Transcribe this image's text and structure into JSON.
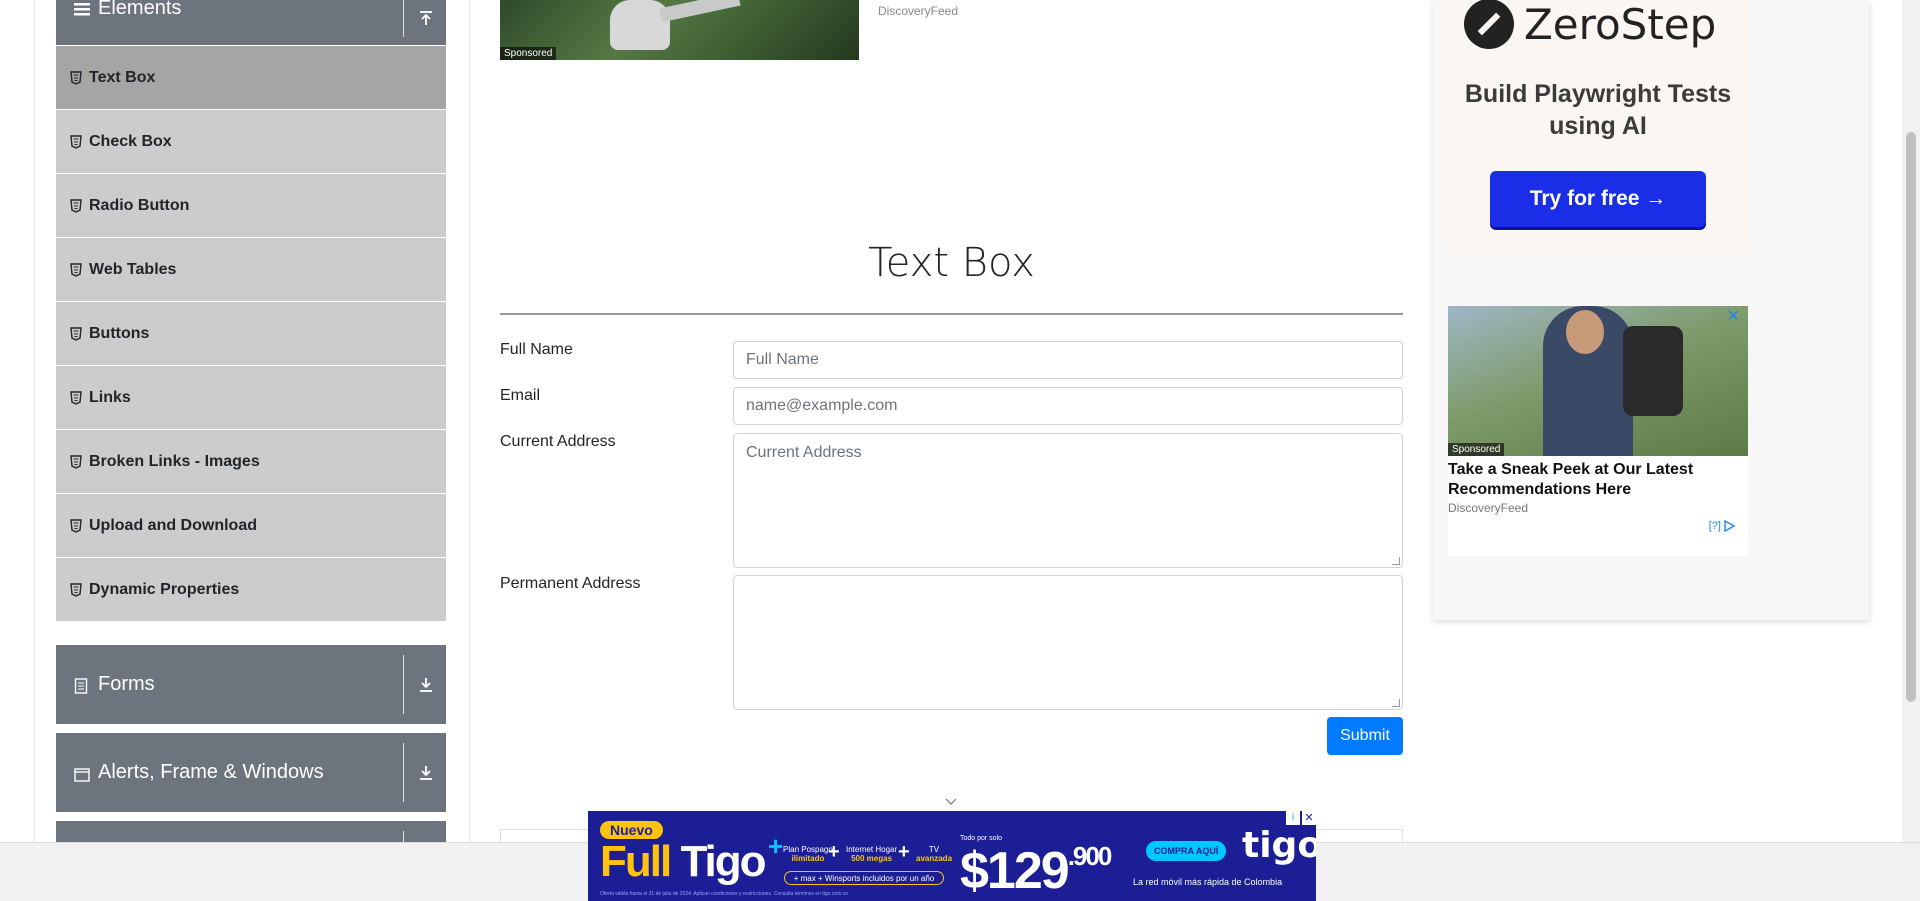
{
  "sidebar": {
    "elements_group": {
      "label": "Elements"
    },
    "items": [
      {
        "label": "Text Box",
        "active": true
      },
      {
        "label": "Check Box"
      },
      {
        "label": "Radio Button"
      },
      {
        "label": "Web Tables"
      },
      {
        "label": "Buttons"
      },
      {
        "label": "Links"
      },
      {
        "label": "Broken Links - Images"
      },
      {
        "label": "Upload and Download"
      },
      {
        "label": "Dynamic Properties"
      }
    ],
    "forms_group": {
      "label": "Forms"
    },
    "alerts_group": {
      "label": "Alerts, Frame & Windows"
    }
  },
  "top_ad": {
    "sponsored": "Sponsored",
    "source": "DiscoveryFeed"
  },
  "main": {
    "title": "Text Box",
    "fields": {
      "full_name": {
        "label": "Full Name",
        "placeholder": "Full Name"
      },
      "email": {
        "label": "Email",
        "placeholder": "name@example.com"
      },
      "current_address": {
        "label": "Current Address",
        "placeholder": "Current Address"
      },
      "permanent_address": {
        "label": "Permanent Address",
        "placeholder": ""
      }
    },
    "submit_label": "Submit"
  },
  "right_ad": {
    "zerostep": {
      "logo": "ZeroStep",
      "headline": "Build Playwright Tests using AI",
      "cta": "Try for free →"
    },
    "discovery": {
      "sponsored": "Sponsored",
      "close": "✕",
      "headline": "Take a Sneak Peek at Our Latest Recommendations Here",
      "source": "DiscoveryFeed",
      "adchoice": "[?]"
    }
  },
  "banner": {
    "badge": "Nuevo",
    "brand_a": "Full",
    "brand_b": "Tigo",
    "plus": "+",
    "feature1": "Plan Pospago",
    "feature1_b": "ilimitado",
    "feature2": "Internet Hogar",
    "feature2_b": "500 megas",
    "feature3": "TV",
    "feature3_b": "avanzada",
    "pill": "+ max + Winsports incluidos por un año",
    "price_pre": "Todo por solo",
    "price_main": "$129",
    "price_cents": ".900",
    "cta": "COMPRA AQUÍ",
    "logo": "tigo",
    "tagline": "La red móvil más rápida de Colombia",
    "fine": "Oferta válida hasta el 31 de julio de 2024. Aplican condiciones y restricciones. Consulta términos en tigo.com.co",
    "close": "✕",
    "info": "i"
  },
  "colors": {
    "sidebar_header": "#6c757d",
    "menu_item": "#cccccc",
    "menu_item_active": "#a5a5a5",
    "primary": "#007bff",
    "zerostep_cta": "#1a2ee8",
    "banner_bg": "#1b1e94",
    "banner_accent": "#ffc20e"
  },
  "icons": {
    "elements_group": "hamburger-icon",
    "menu_item": "html5-shield-icon",
    "group_collapse": "upload-arrow-icon",
    "group_expand": "download-arrow-icon",
    "forms_group": "document-icon",
    "alerts_group": "window-icon"
  }
}
